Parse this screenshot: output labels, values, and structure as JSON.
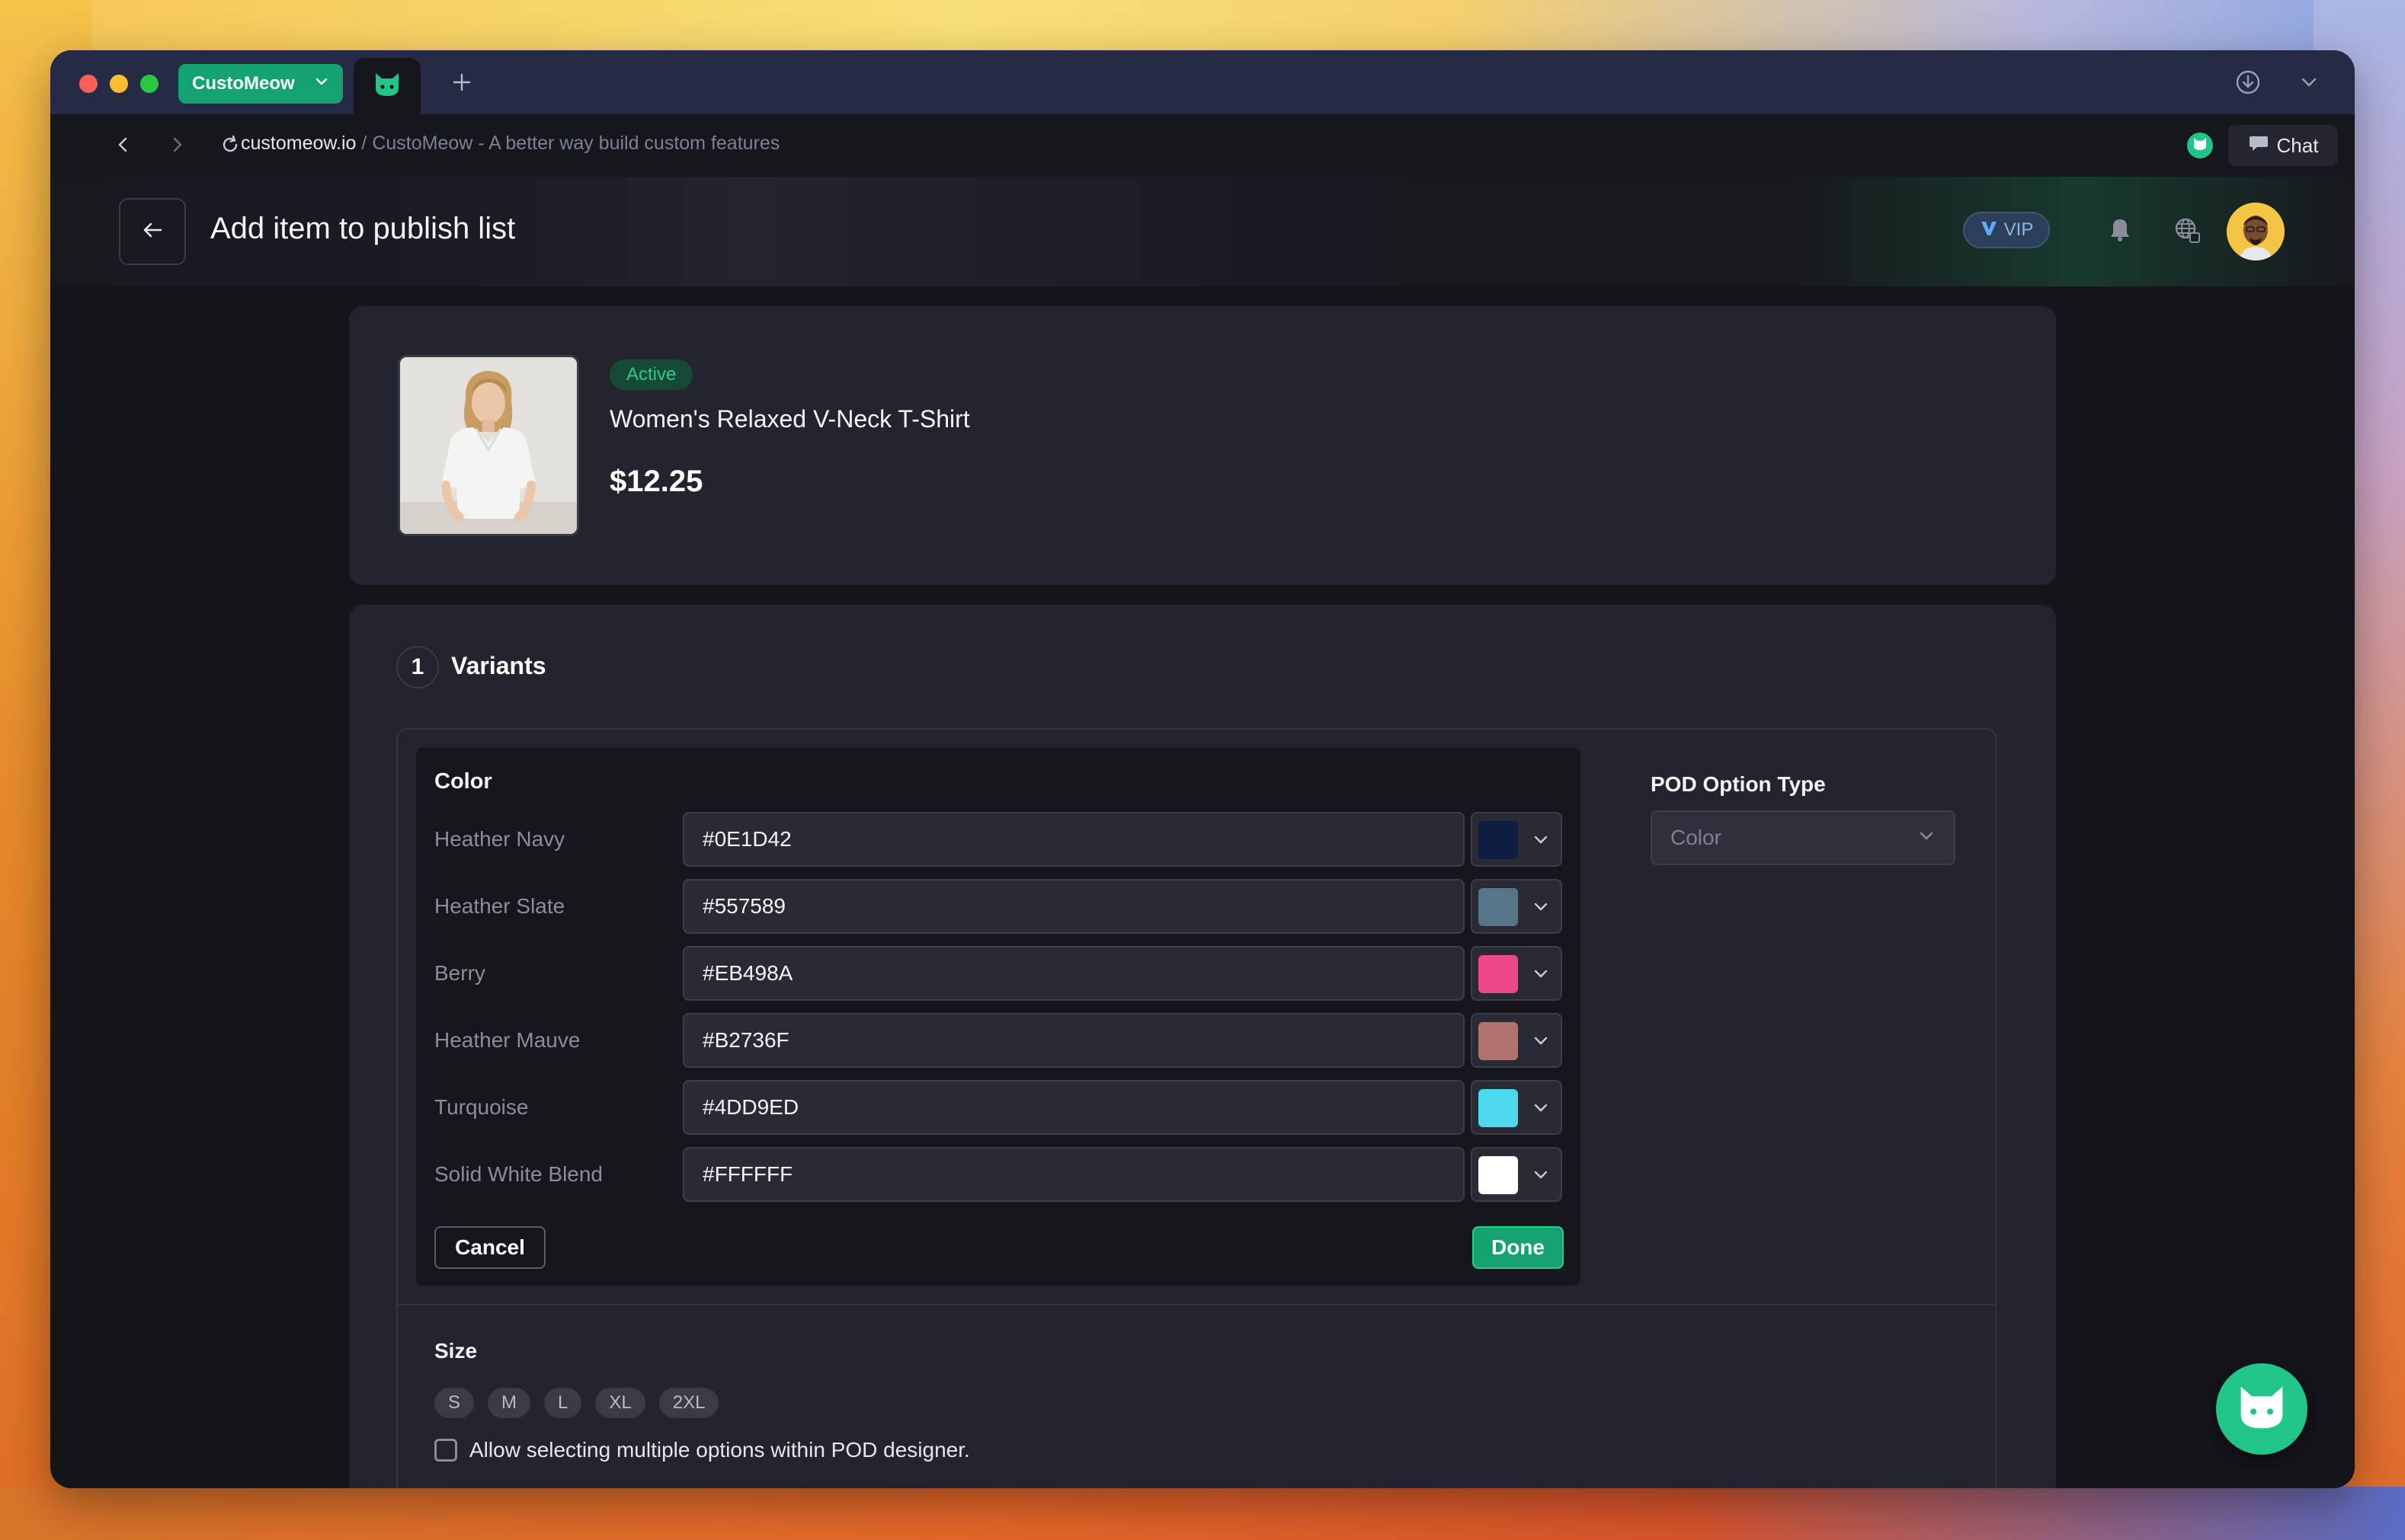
{
  "browser": {
    "workspace_label": "CustoMeow",
    "url_domain": "customeow.io",
    "url_separator": " / ",
    "page_title_text": "CustoMeow - A better way build custom features",
    "chat_label": "Chat"
  },
  "header": {
    "title": "Add item to publish list",
    "vip_label": "VIP"
  },
  "product": {
    "status": "Active",
    "name": "Women's Relaxed V-Neck T-Shirt",
    "price": "$12.25"
  },
  "variants": {
    "step_number": "1",
    "title": "Variants",
    "color_section_title": "Color",
    "colors": [
      {
        "name": "Heather Navy",
        "hex": "#0E1D42"
      },
      {
        "name": "Heather Slate",
        "hex": "#557589"
      },
      {
        "name": "Berry",
        "hex": "#EB498A"
      },
      {
        "name": "Heather Mauve",
        "hex": "#B2736F"
      },
      {
        "name": "Turquoise",
        "hex": "#4DD9ED"
      },
      {
        "name": "Solid White Blend",
        "hex": "#FFFFFF"
      }
    ],
    "cancel_label": "Cancel",
    "done_label": "Done",
    "pod_option_type_label": "POD Option Type",
    "pod_option_type_value": "Color",
    "size_title": "Size",
    "sizes": [
      "S",
      "M",
      "L",
      "XL",
      "2XL"
    ],
    "multi_select_label": "Allow selecting multiple options within POD designer."
  },
  "colors": {
    "accent": "#13A36E",
    "active_badge_bg": "#144A36",
    "active_badge_text": "#2FCB8A",
    "vip_text": "#8EB5E3"
  }
}
